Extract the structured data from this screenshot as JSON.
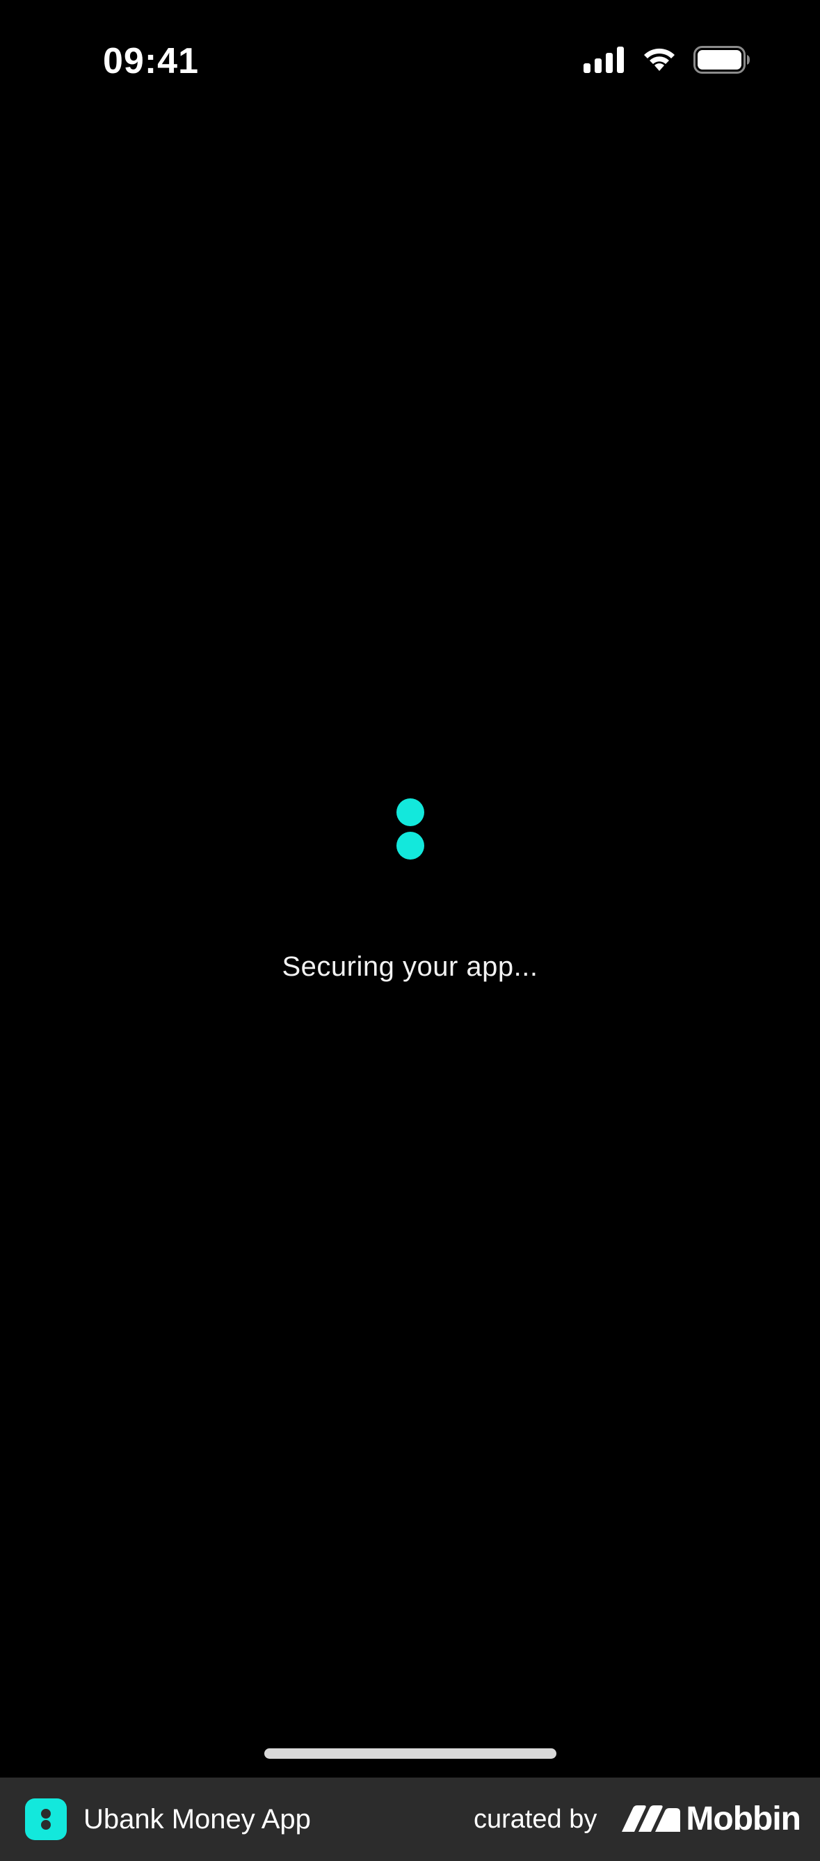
{
  "status_bar": {
    "time": "09:41",
    "icons": [
      "cellular-signal-icon",
      "wifi-icon",
      "battery-icon"
    ]
  },
  "loader": {
    "icon": "loading-dots-icon",
    "color": "#13E8DC"
  },
  "loading_message": "Securing your app...",
  "footer": {
    "app_icon": "ubank-app-icon",
    "app_name": "Ubank Money App",
    "curated_label": "curated by",
    "brand_icon": "mobbin-logo-icon",
    "brand_name": "Mobbin",
    "background": "#2C2C2C"
  },
  "colors": {
    "background": "#000000",
    "accent": "#13E8DC",
    "text": "#FFFFFF"
  }
}
